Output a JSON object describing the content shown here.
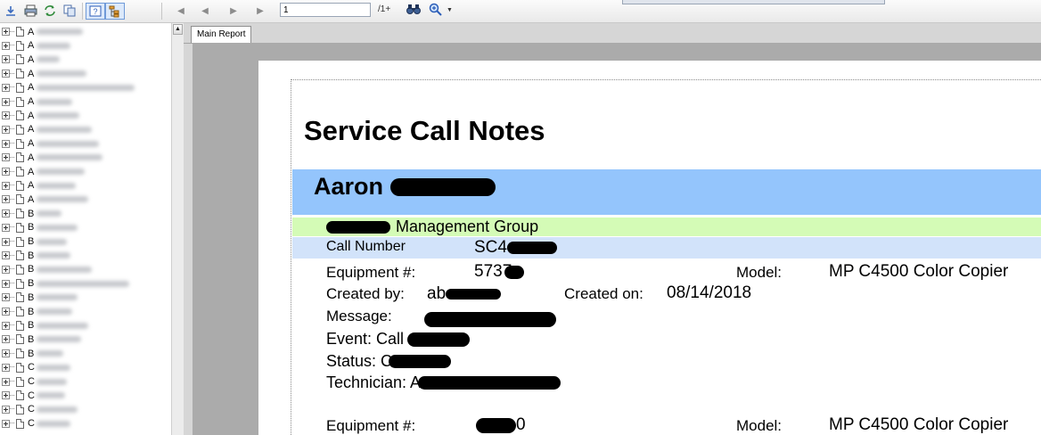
{
  "toolbar": {
    "icons": [
      "export-icon",
      "print-icon",
      "refresh-icon",
      "copy-icon",
      "help-icon",
      "group-tree-icon"
    ],
    "nav_icons": [
      "first-page-icon",
      "previous-page-icon",
      "next-page-icon",
      "last-page-icon"
    ],
    "page_number": "1",
    "page_total": "/1+",
    "search_icon": "binoculars-icon",
    "zoom_icon": "magnifier-icon"
  },
  "tree": {
    "items": [
      {
        "letter": "A"
      },
      {
        "letter": "A"
      },
      {
        "letter": "A"
      },
      {
        "letter": "A"
      },
      {
        "letter": "A"
      },
      {
        "letter": "A"
      },
      {
        "letter": "A"
      },
      {
        "letter": "A"
      },
      {
        "letter": "A"
      },
      {
        "letter": "A"
      },
      {
        "letter": "A"
      },
      {
        "letter": "A"
      },
      {
        "letter": "A"
      },
      {
        "letter": "B"
      },
      {
        "letter": "B"
      },
      {
        "letter": "B"
      },
      {
        "letter": "B"
      },
      {
        "letter": "B"
      },
      {
        "letter": "B"
      },
      {
        "letter": "B"
      },
      {
        "letter": "B"
      },
      {
        "letter": "B"
      },
      {
        "letter": "B"
      },
      {
        "letter": "B"
      },
      {
        "letter": "C"
      },
      {
        "letter": "C"
      },
      {
        "letter": "C"
      },
      {
        "letter": "C"
      },
      {
        "letter": "C"
      }
    ]
  },
  "report": {
    "tab_label": "Main Report",
    "title": "Service Call Notes",
    "customer_first": "Aaron",
    "company_suffix": "Management Group",
    "call_number_label": "Call Number",
    "call_number_prefix": "SC4",
    "entries": [
      {
        "equipment_label": "Equipment #:",
        "equipment_prefix": "5737",
        "model_label": "Model:",
        "model_value": "MP C4500 Color Copier",
        "created_by_label": "Created by:",
        "created_by_prefix": "ab",
        "created_on_label": "Created on:",
        "created_on_value": "08/14/2018",
        "message_label": "Message:",
        "event_label": "Event: Call",
        "status_label": "Status: C",
        "technician_label": "Technician: A"
      },
      {
        "equipment_label": "Equipment #:",
        "equipment_suffix": "0",
        "model_label": "Model:",
        "model_value": "MP C4500 Color Copier"
      }
    ]
  },
  "colors": {
    "customer_band": "#94c5fc",
    "company_band": "#d4fbb6",
    "call_band": "#d2e3fa",
    "toolbar_icon": "#2b5db8"
  }
}
